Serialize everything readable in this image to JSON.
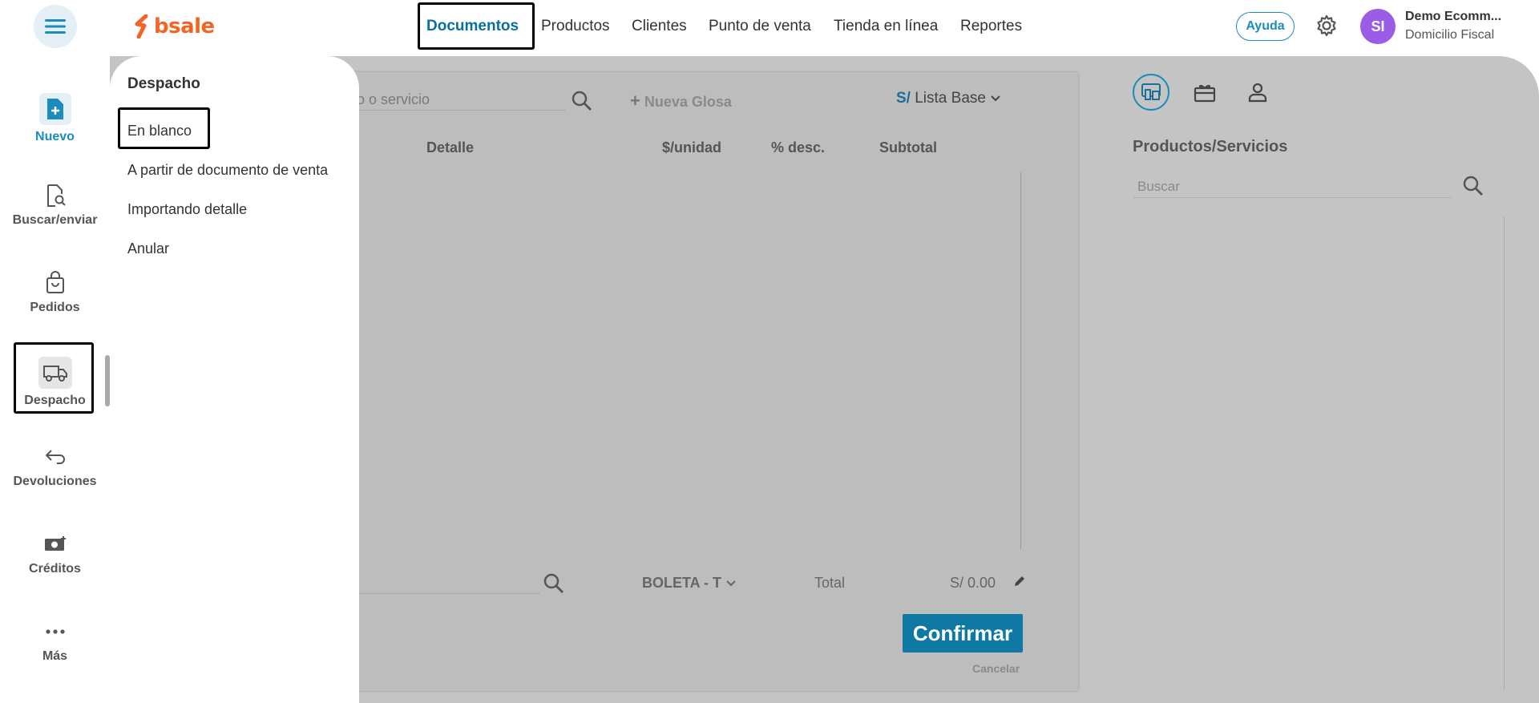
{
  "topbar": {
    "logo_text": "bsale",
    "nav": [
      "Documentos",
      "Productos",
      "Clientes",
      "Punto de venta",
      "Tienda en línea",
      "Reportes"
    ],
    "help_label": "Ayuda",
    "avatar_initials": "SI",
    "user_name": "Demo Ecomm...",
    "user_sub": "Domicilio Fiscal"
  },
  "sidebar": {
    "items": [
      {
        "label": "Nuevo",
        "icon": "file-plus-icon"
      },
      {
        "label": "Buscar/enviar",
        "icon": "file-search-icon"
      },
      {
        "label": "Pedidos",
        "icon": "shopping-bag-icon"
      },
      {
        "label": "Despacho",
        "icon": "truck-icon"
      },
      {
        "label": "Devoluciones",
        "icon": "return-arrow-icon"
      },
      {
        "label": "Créditos",
        "icon": "money-icon"
      },
      {
        "label": "Más",
        "icon": "more-dots-icon"
      }
    ]
  },
  "dropdown": {
    "title": "Despacho",
    "items": [
      "En blanco",
      "A partir de documento de venta",
      "Importando detalle",
      "Anular"
    ]
  },
  "document": {
    "search_placeholder_partial": "o o servicio",
    "new_glosa": "Nueva Glosa",
    "currency_symbol": "S/",
    "price_list": "Lista Base",
    "columns": [
      "Detalle",
      "$/unidad",
      "% desc.",
      "Subtotal"
    ],
    "doc_type": "BOLETA - T",
    "total_label": "Total",
    "total_value": "S/ 0.00",
    "confirm_label": "Confirmar",
    "cancel_label": "Cancelar"
  },
  "right_panel": {
    "title": "Productos/Servicios",
    "search_placeholder": "Buscar"
  },
  "colors": {
    "brand_orange": "#f26522",
    "accent_blue": "#1a8cbd",
    "avatar_purple": "#9b5de5",
    "confirm_blue": "#0f78a3"
  }
}
